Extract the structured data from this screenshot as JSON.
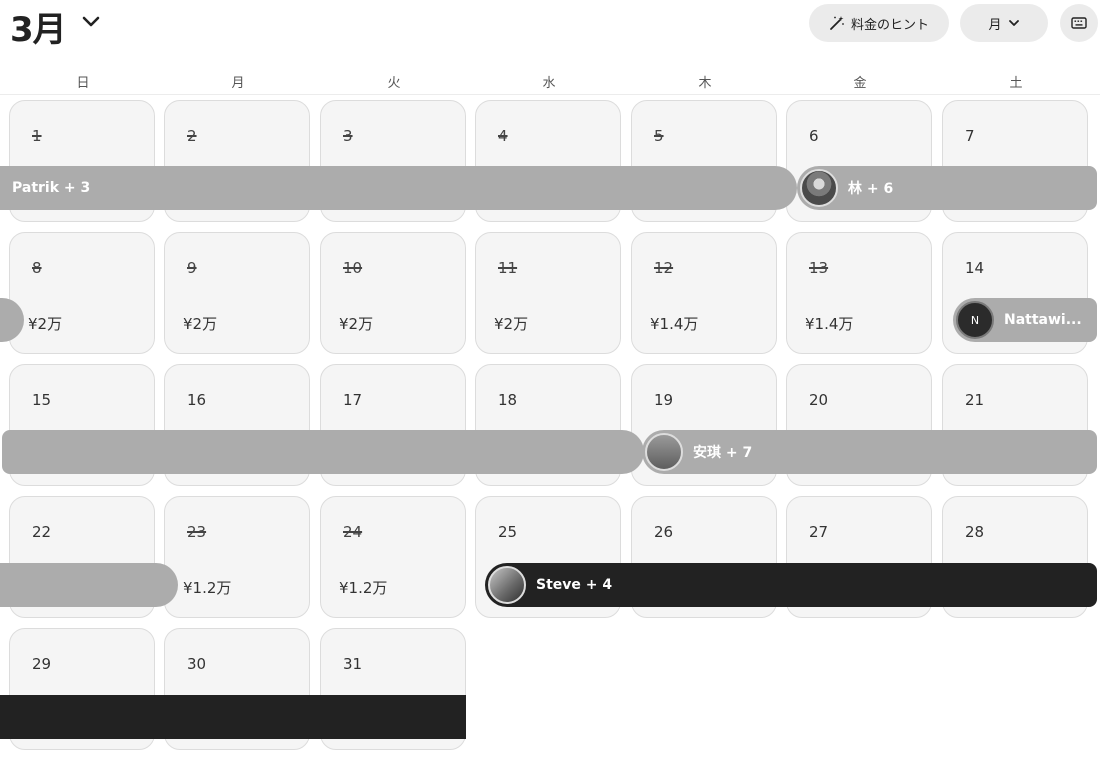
{
  "header": {
    "month_title": "3月",
    "hint_label": "料金のヒント",
    "view_label": "月"
  },
  "weekdays": [
    "日",
    "月",
    "火",
    "水",
    "木",
    "金",
    "土"
  ],
  "days": [
    {
      "day": "1",
      "struck": true,
      "price": ""
    },
    {
      "day": "2",
      "struck": true,
      "price": ""
    },
    {
      "day": "3",
      "struck": true,
      "price": ""
    },
    {
      "day": "4",
      "struck": true,
      "price": ""
    },
    {
      "day": "5",
      "struck": true,
      "price": ""
    },
    {
      "day": "6",
      "struck": false,
      "price": ""
    },
    {
      "day": "7",
      "struck": false,
      "price": ""
    },
    {
      "day": "8",
      "struck": true,
      "price": "¥2万"
    },
    {
      "day": "9",
      "struck": true,
      "price": "¥2万"
    },
    {
      "day": "10",
      "struck": true,
      "price": "¥2万"
    },
    {
      "day": "11",
      "struck": true,
      "price": "¥2万"
    },
    {
      "day": "12",
      "struck": true,
      "price": "¥1.4万"
    },
    {
      "day": "13",
      "struck": true,
      "price": "¥1.4万"
    },
    {
      "day": "14",
      "struck": false,
      "price": ""
    },
    {
      "day": "15",
      "struck": false,
      "price": ""
    },
    {
      "day": "16",
      "struck": false,
      "price": ""
    },
    {
      "day": "17",
      "struck": false,
      "price": ""
    },
    {
      "day": "18",
      "struck": false,
      "price": ""
    },
    {
      "day": "19",
      "struck": false,
      "price": ""
    },
    {
      "day": "20",
      "struck": false,
      "price": ""
    },
    {
      "day": "21",
      "struck": false,
      "price": ""
    },
    {
      "day": "22",
      "struck": false,
      "price": ""
    },
    {
      "day": "23",
      "struck": true,
      "price": "¥1.2万"
    },
    {
      "day": "24",
      "struck": true,
      "price": "¥1.2万"
    },
    {
      "day": "25",
      "struck": false,
      "price": ""
    },
    {
      "day": "26",
      "struck": false,
      "price": ""
    },
    {
      "day": "27",
      "struck": false,
      "price": ""
    },
    {
      "day": "28",
      "struck": false,
      "price": ""
    },
    {
      "day": "29",
      "struck": false,
      "price": ""
    },
    {
      "day": "30",
      "struck": false,
      "price": ""
    },
    {
      "day": "31",
      "struck": false,
      "price": ""
    }
  ],
  "reservations": {
    "patrik": {
      "label": "Patrik + 3"
    },
    "lin": {
      "label": "林 + 6"
    },
    "nattawi": {
      "label": "Nattawi...",
      "initial": "N"
    },
    "anqi": {
      "label": "安琪 + 7"
    },
    "steve": {
      "label": "Steve + 4"
    }
  }
}
